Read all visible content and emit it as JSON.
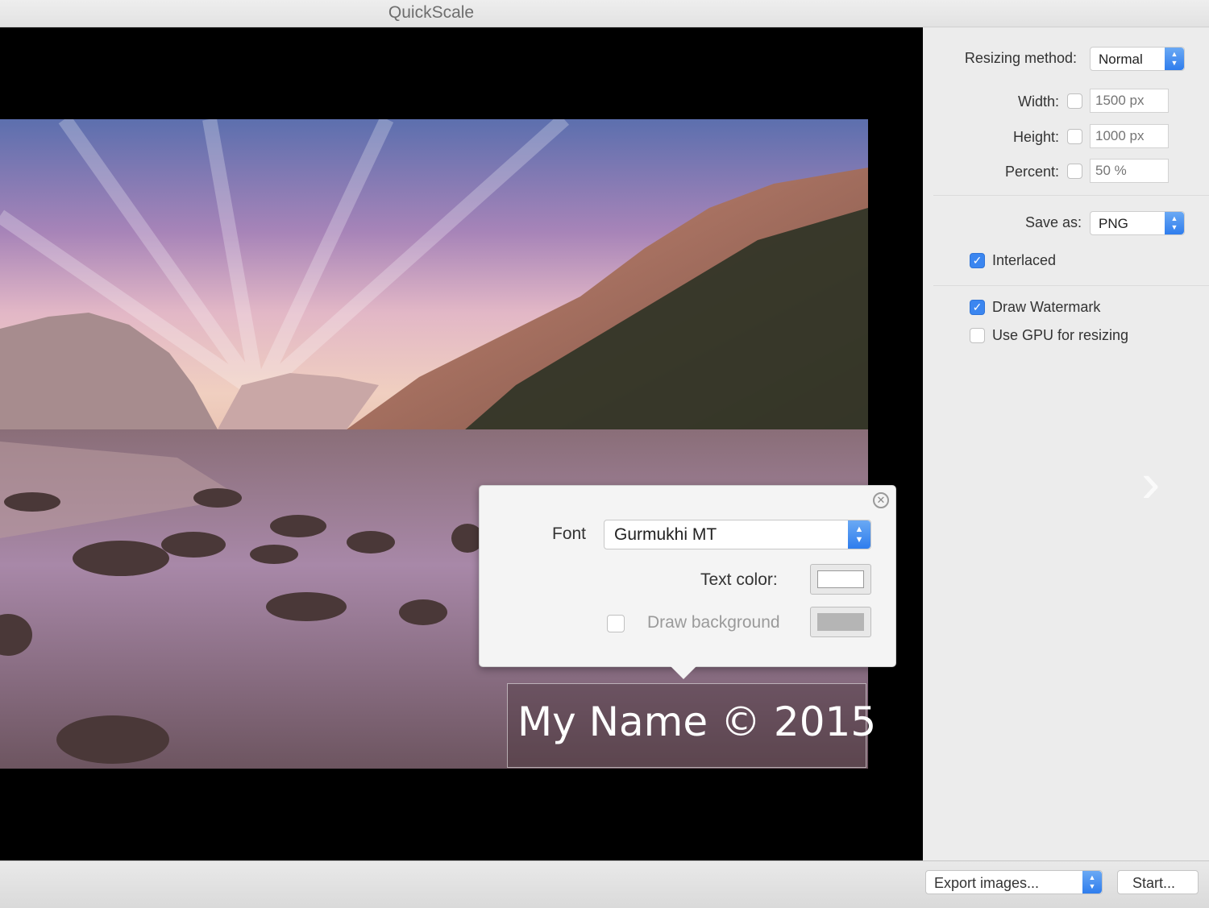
{
  "window": {
    "title": "QuickScale"
  },
  "watermark": {
    "text": "My Name © 2015"
  },
  "popover": {
    "font_label": "Font",
    "font_value": "Gurmukhi MT",
    "text_color_label": "Text color:",
    "text_color_value": "#ffffff",
    "draw_background_label": "Draw background",
    "draw_background_checked": false,
    "background_color_value": "#b5b5b5",
    "close_icon": "close-circle-icon"
  },
  "sidebar": {
    "resizing_method_label": "Resizing method:",
    "resizing_method_value": "Normal",
    "width_label": "Width:",
    "width_placeholder": "1500 px",
    "height_label": "Height:",
    "height_placeholder": "1000 px",
    "percent_label": "Percent:",
    "percent_placeholder": "50 %",
    "save_as_label": "Save as:",
    "save_as_value": "PNG",
    "interlaced_label": "Interlaced",
    "interlaced_checked": true,
    "draw_watermark_label": "Draw Watermark",
    "draw_watermark_checked": true,
    "use_gpu_label": "Use GPU for resizing",
    "use_gpu_checked": false,
    "next_icon": "chevron-right-icon"
  },
  "bottombar": {
    "export_label": "Export images...",
    "start_label": "Start..."
  },
  "colors": {
    "accent": "#3b86f0",
    "preview_bg": "#000000"
  }
}
